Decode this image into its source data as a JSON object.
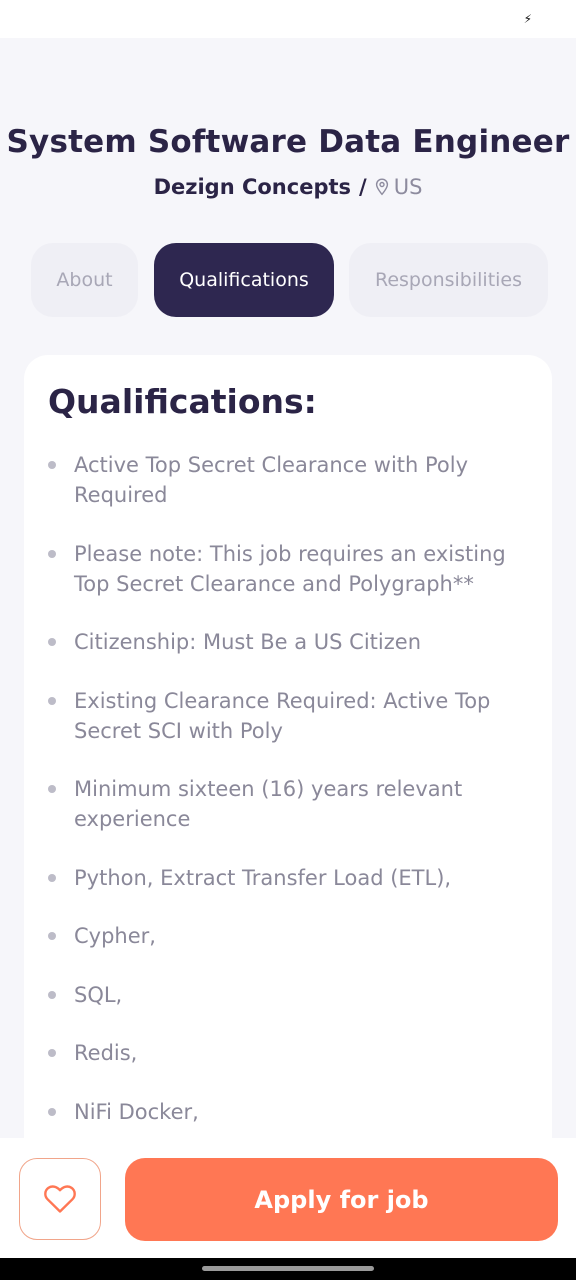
{
  "status_bar": {
    "charging_icon": "bolt-icon"
  },
  "header": {
    "title": "System Software Data Engineer",
    "company": "Dezign Concepts",
    "separator": "/",
    "location": "US",
    "location_icon": "map-pin-icon"
  },
  "tabs": [
    {
      "label": "About",
      "active": false
    },
    {
      "label": "Qualifications",
      "active": true
    },
    {
      "label": "Responsibilities",
      "active": false
    }
  ],
  "qualifications": {
    "title": "Qualifications:",
    "items": [
      "Active Top Secret Clearance with Poly Required",
      "Please note: This job requires an existing Top Secret Clearance and Polygraph**",
      "Citizenship: Must Be a US Citizen",
      "Existing Clearance Required: Active Top Secret SCI with Poly",
      "Minimum sixteen (16) years relevant experience",
      "Python, Extract Transfer Load (ETL),",
      "Cypher,",
      "SQL,",
      "Redis,",
      "NiFi Docker,"
    ]
  },
  "footer": {
    "favorite_icon": "heart-icon",
    "apply_label": "Apply for job"
  },
  "colors": {
    "primary_dark": "#2E2750",
    "accent_orange": "#FF7754",
    "background": "#F6F6FA"
  }
}
